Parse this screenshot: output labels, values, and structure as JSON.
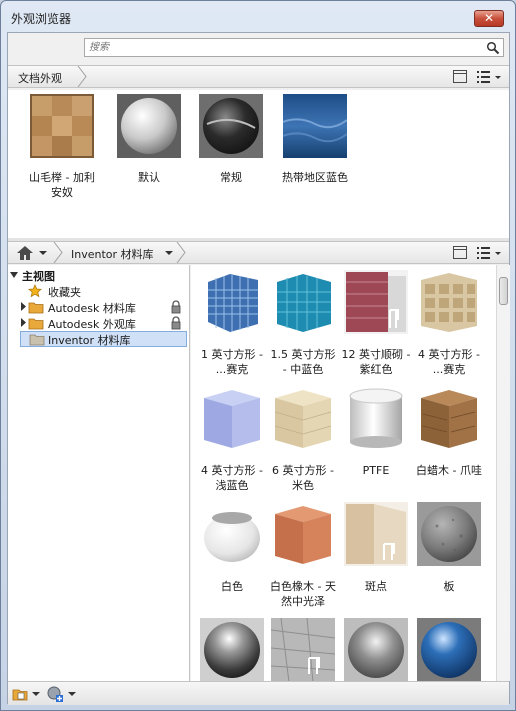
{
  "window": {
    "title": "外观浏览器",
    "close_glyph": "✕"
  },
  "search": {
    "placeholder": "搜索",
    "value": ""
  },
  "document_bar": {
    "label": "文档外观"
  },
  "document_materials": [
    {
      "label": "山毛榉 - 加利安奴",
      "swatch": "wood-block"
    },
    {
      "label": "默认",
      "swatch": "default-sphere"
    },
    {
      "label": "常规",
      "swatch": "dark-sphere"
    },
    {
      "label": "热带地区蓝色",
      "swatch": "blue-water"
    }
  ],
  "library_bar": {
    "home_icon": "home-icon",
    "label": "Inventor 材料库"
  },
  "tree": {
    "root": "主视图",
    "items": [
      {
        "label": "收藏夹",
        "icon": "star-icon",
        "locked": false,
        "selected": false
      },
      {
        "label": "Autodesk 材料库",
        "icon": "folder-icon",
        "locked": true,
        "selected": false
      },
      {
        "label": "Autodesk 外观库",
        "icon": "folder-icon",
        "locked": true,
        "selected": false
      },
      {
        "label": "Inventor 材料库",
        "icon": "folder-icon",
        "locked": false,
        "selected": true
      }
    ]
  },
  "library_materials": [
    {
      "label": "1 英寸方形 - ...赛克",
      "swatch": "mosaic-blue"
    },
    {
      "label": "1.5 英寸方形 - 中蓝色",
      "swatch": "tile-teal"
    },
    {
      "label": "12 英寸顺砌 - 紫红色",
      "swatch": "brick-maroon"
    },
    {
      "label": "4 英寸方形 - ...赛克",
      "swatch": "tile-beige"
    },
    {
      "label": "4 英寸方形 - 浅蓝色",
      "swatch": "cube-lightblue"
    },
    {
      "label": "6 英寸方形 - 米色",
      "swatch": "cube-beige"
    },
    {
      "label": "PTFE",
      "swatch": "cylinder-white"
    },
    {
      "label": "白蜡木 - 爪哇",
      "swatch": "cube-wood"
    },
    {
      "label": "白色",
      "swatch": "bowl-white"
    },
    {
      "label": "白色橡木 - 天然中光泽",
      "swatch": "cube-orange"
    },
    {
      "label": "斑点",
      "swatch": "chair-beige"
    },
    {
      "label": "板",
      "swatch": "sphere-granite"
    },
    {
      "label": "",
      "swatch": "sphere-chrome"
    },
    {
      "label": "",
      "swatch": "chair-rough"
    },
    {
      "label": "",
      "swatch": "sphere-steel"
    },
    {
      "label": "",
      "swatch": "sphere-blue"
    }
  ],
  "colors": {
    "accent_selection": "#cfe0f7",
    "close_button": "#c8503c"
  }
}
